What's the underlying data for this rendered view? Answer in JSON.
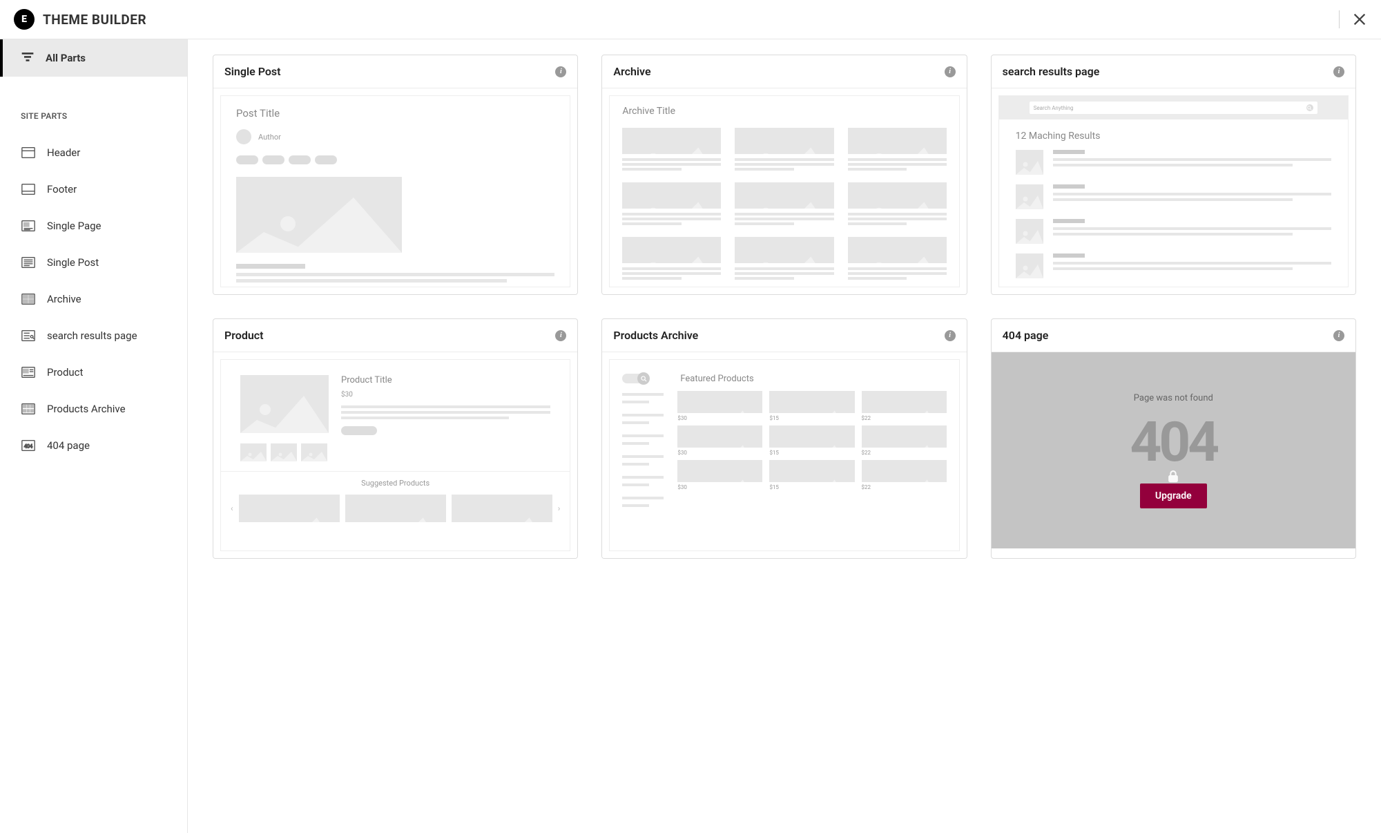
{
  "header": {
    "logo_text": "E",
    "title": "THEME BUILDER"
  },
  "sidebar": {
    "all_parts_label": "All Parts",
    "section_label": "SITE PARTS",
    "items": [
      {
        "label": "Header"
      },
      {
        "label": "Footer"
      },
      {
        "label": "Single Page"
      },
      {
        "label": "Single Post"
      },
      {
        "label": "Archive"
      },
      {
        "label": "search results page"
      },
      {
        "label": "Product"
      },
      {
        "label": "Products Archive"
      },
      {
        "label": "404 page"
      }
    ]
  },
  "cards": {
    "single_post": {
      "title": "Single Post",
      "post_title_label": "Post Title",
      "author_label": "Author"
    },
    "archive": {
      "title": "Archive",
      "archive_title_label": "Archive Title"
    },
    "search_results": {
      "title": "search results page",
      "placeholder": "Search Anything",
      "count_label": "12 Maching Results"
    },
    "product": {
      "title": "Product",
      "product_title_label": "Product Title",
      "price": "$30",
      "suggested_label": "Suggested Products"
    },
    "products_archive": {
      "title": "Products Archive",
      "featured_label": "Featured Products",
      "prices": [
        "$30",
        "$15",
        "$22",
        "$30",
        "$15",
        "$22",
        "$30",
        "$15",
        "$22"
      ]
    },
    "not_found": {
      "title": "404 page",
      "subtitle": "Page was not found",
      "big": "404",
      "upgrade_label": "Upgrade"
    }
  }
}
